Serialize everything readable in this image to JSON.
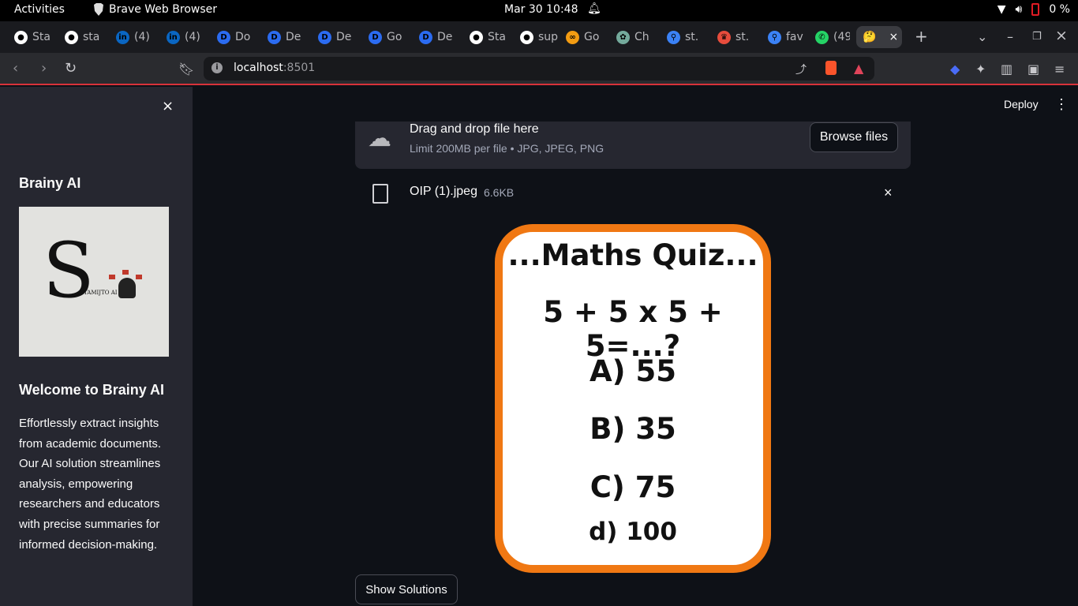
{
  "system": {
    "activities": "Activities",
    "app_name": "Brave Web Browser",
    "clock": "Mar 30  10:48",
    "battery": "0 %"
  },
  "tabs": [
    {
      "label": "Sta",
      "icon": "github-icon",
      "color": "#ffffff"
    },
    {
      "label": "sta",
      "icon": "github-icon",
      "color": "#ffffff"
    },
    {
      "label": "(4)",
      "icon": "linkedin-icon",
      "color": "#0a66c2"
    },
    {
      "label": "(4)",
      "icon": "linkedin-icon",
      "color": "#0a66c2"
    },
    {
      "label": "Do",
      "icon": "d-icon",
      "color": "#2b6bf0"
    },
    {
      "label": "De",
      "icon": "d-icon",
      "color": "#2b6bf0"
    },
    {
      "label": "De",
      "icon": "d-icon",
      "color": "#2b6bf0"
    },
    {
      "label": "Go",
      "icon": "d-icon",
      "color": "#2b6bf0"
    },
    {
      "label": "De",
      "icon": "d-icon",
      "color": "#2b6bf0"
    },
    {
      "label": "Sta",
      "icon": "github-icon",
      "color": "#ffffff"
    },
    {
      "label": "sup",
      "icon": "github-icon",
      "color": "#ffffff"
    },
    {
      "label": "Go",
      "icon": "infinity-icon",
      "color": "#f39c12"
    },
    {
      "label": "Ch",
      "icon": "chatgpt-icon",
      "color": "#74aa9c"
    },
    {
      "label": "st.",
      "icon": "search-icon",
      "color": "#3b82f6"
    },
    {
      "label": "st.",
      "icon": "crown-icon",
      "color": "#e74c3c"
    },
    {
      "label": "fav",
      "icon": "search-icon",
      "color": "#3b82f6"
    },
    {
      "label": "(49",
      "icon": "whatsapp-icon",
      "color": "#25d366"
    }
  ],
  "active_tab": {
    "emoji": "🤔",
    "close": "×"
  },
  "tab_controls": {
    "new_tab": "+",
    "dropdown": "⌄",
    "minimize": "–",
    "restore": "❐",
    "close": "×"
  },
  "address": {
    "host": "localhost",
    "port": ":8501"
  },
  "sidebar": {
    "close": "×",
    "title": "Brainy AI",
    "logo_letter": "S",
    "logo_caption": "TAMIJTO AI",
    "welcome": "Welcome to Brainy AI",
    "description": "Effortlessly extract insights from academic documents. Our AI solution streamlines analysis, empowering researchers and educators with precise summaries for informed decision-making."
  },
  "header": {
    "deploy": "Deploy",
    "menu": "⋮"
  },
  "uploader": {
    "drag_text": "Drag and drop file here",
    "limit_text": "Limit 200MB per file • JPG, JPEG, PNG",
    "browse_label": "Browse files"
  },
  "file": {
    "name": "OIP (1).jpeg",
    "size": "6.6KB",
    "remove": "×"
  },
  "quiz_image": {
    "title": "...Maths Quiz...",
    "equation": "5 + 5 x 5 + 5=...?",
    "option_a": "A) 55",
    "option_b": "B) 35",
    "option_c": "C) 75",
    "option_d": "d) 100",
    "border_color": "#f07813"
  },
  "actions": {
    "show_solutions": "Show Solutions"
  }
}
